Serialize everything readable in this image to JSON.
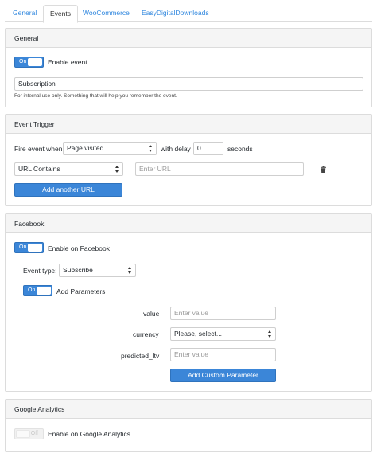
{
  "tabs": [
    "General",
    "Events",
    "WooCommerce",
    "EasyDigitalDownloads"
  ],
  "general": {
    "title": "General",
    "toggle_label": "On",
    "enable_label": "Enable event",
    "name_value": "Subscription",
    "help_text": "For internal use only. Something that will help you remember the event."
  },
  "trigger": {
    "title": "Event Trigger",
    "fire_label": "Fire event when",
    "fire_select": "Page visited",
    "delay_label": "with delay",
    "delay_value": "0",
    "seconds_label": "seconds",
    "url_select": "URL Contains",
    "url_placeholder": "Enter URL",
    "add_url_button": "Add another URL"
  },
  "facebook": {
    "title": "Facebook",
    "toggle_label": "On",
    "enable_label": "Enable on Facebook",
    "event_type_label": "Event type:",
    "event_type_value": "Subscribe",
    "params_toggle_label": "On",
    "params_label": "Add Parameters",
    "params": [
      {
        "name": "value",
        "type": "input",
        "placeholder": "Enter value"
      },
      {
        "name": "currency",
        "type": "select",
        "value": "Please, select..."
      },
      {
        "name": "predicted_ltv",
        "type": "input",
        "placeholder": "Enter value"
      }
    ],
    "add_param_button": "Add Custom Parameter"
  },
  "ga": {
    "title": "Google Analytics",
    "toggle_label": "Off",
    "enable_label": "Enable on Google Analytics"
  },
  "colors": {
    "accent": "#3b86d8",
    "link": "#2e86de",
    "panel_header": "#f5f5f5",
    "border": "#dcdcdc"
  },
  "icons": {
    "delete_url": "trash-icon"
  }
}
